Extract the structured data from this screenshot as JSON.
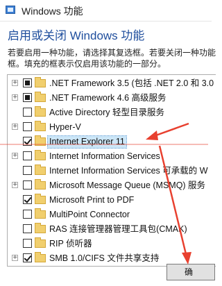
{
  "window": {
    "title": "Windows 功能",
    "heading": "启用或关闭 Windows 功能",
    "description_lines": [
      "若要启用一种功能，请选择其复选框。若要关闭一种功能",
      "框。填充的框表示仅启用该功能的一部分。"
    ]
  },
  "features": [
    {
      "label": ".NET Framework 3.5 (包括 .NET 2.0 和 3.0",
      "state": "partial",
      "expandable": true
    },
    {
      "label": ".NET Framework 4.6 高级服务",
      "state": "partial",
      "expandable": true
    },
    {
      "label": "Active Directory 轻型目录服务",
      "state": "unchecked",
      "expandable": false
    },
    {
      "label": "Hyper-V",
      "state": "unchecked",
      "expandable": true
    },
    {
      "label": "Internet Explorer 11",
      "state": "checked",
      "expandable": false,
      "selected": true
    },
    {
      "label": "Internet Information Services",
      "state": "unchecked",
      "expandable": true
    },
    {
      "label": "Internet Information Services 可承载的 W",
      "state": "unchecked",
      "expandable": false
    },
    {
      "label": "Microsoft Message Queue (MSMQ) 服务",
      "state": "unchecked",
      "expandable": true
    },
    {
      "label": "Microsoft Print to PDF",
      "state": "checked",
      "expandable": false
    },
    {
      "label": "MultiPoint Connector",
      "state": "unchecked",
      "expandable": false
    },
    {
      "label": "RAS 连接管理器管理工具包(CMAK)",
      "state": "unchecked",
      "expandable": false
    },
    {
      "label": "RIP 侦听器",
      "state": "unchecked",
      "expandable": false
    },
    {
      "label": "SMB 1.0/CIFS 文件共享支持",
      "state": "checked",
      "expandable": true
    }
  ],
  "buttons": {
    "ok_label": "确"
  },
  "annotation": {
    "arrow_color": "#e8402f"
  }
}
